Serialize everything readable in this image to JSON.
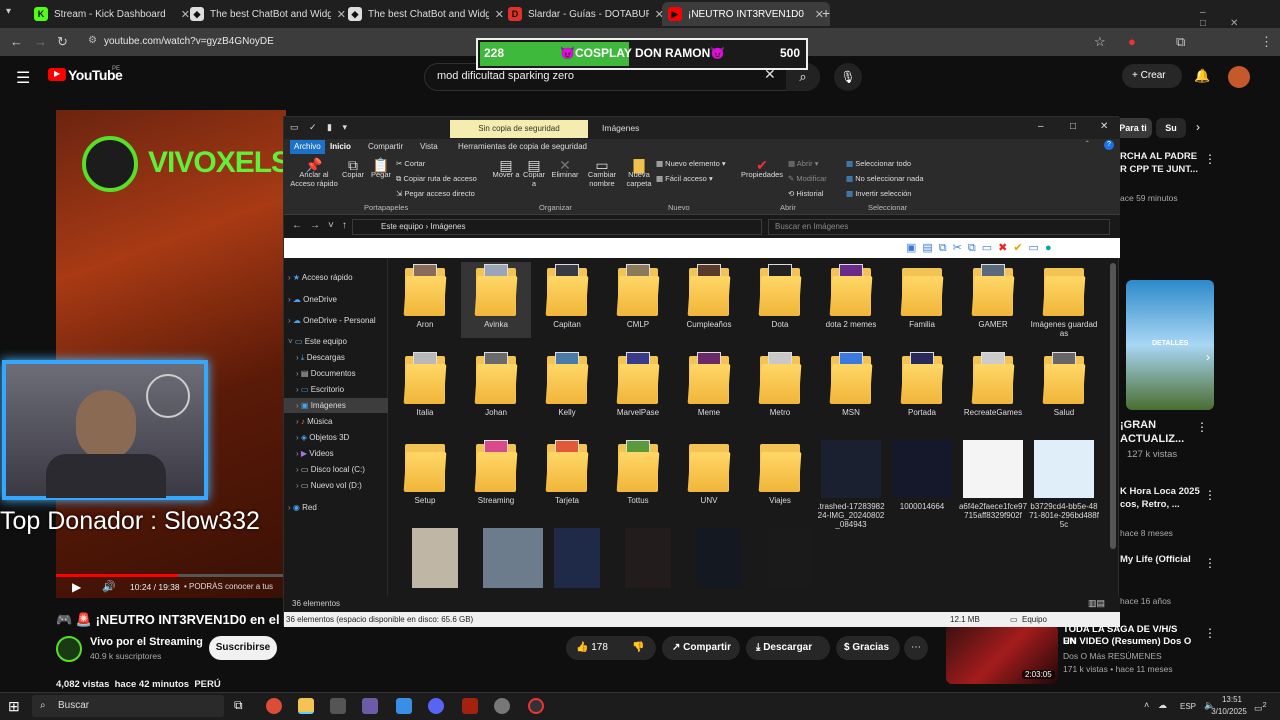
{
  "browser": {
    "tabs": [
      {
        "label": "Stream - Kick Dashboard",
        "icon": "kick-icon",
        "color": "#53fc18",
        "letter": "K"
      },
      {
        "label": "The best ChatBot and Widgets",
        "icon": "botrix-icon",
        "color": "#dddddd",
        "letter": "◆"
      },
      {
        "label": "The best ChatBot and Widgets",
        "icon": "botrix-icon",
        "color": "#dddddd",
        "letter": "◆"
      },
      {
        "label": "Slardar - Guías - DOTABUFF - D",
        "icon": "dotabuff-icon",
        "color": "#e0322b",
        "letter": "D"
      },
      {
        "label": "¡NEUTRO INT3RVEN1D0",
        "icon": "youtube-icon",
        "color": "#ff0000",
        "letter": "▶"
      }
    ],
    "url": "youtube.com/watch?v=gyzB4GNoyDE"
  },
  "donation_goal": {
    "current": "228",
    "title": "😈COSPLAY DON RAMON😈",
    "goal": "500"
  },
  "youtube": {
    "logo": "YouTube",
    "region": "PE",
    "search_value": "mod dificultad sparking zero",
    "create_label": "Crear",
    "chips": [
      "Para ti",
      "Su"
    ],
    "video": {
      "banner": "VIVOXELST",
      "donor_text": "Top Donador : Slow332",
      "time": "10:24 / 19:38",
      "chapter": "• PODRÁS conocer a tus",
      "title": "🎮 🚨 ¡NEUTRO INT3RVEN1D0 en el E",
      "channel": "Vivo por el Streaming",
      "subs": "40.9 k suscriptores",
      "subscribe": "Suscribirse",
      "likes": "178",
      "share": "Compartir",
      "download": "Descargar",
      "thanks": "Gracias",
      "views": "4,082 vistas  hace 42 minutos  PERÚ"
    },
    "related": [
      {
        "title": "RCHA AL PADRE",
        "title2": "R CPP TE JUNT...",
        "meta": "ace 59 minutos"
      },
      {
        "title": "¡GRAN",
        "title2": "ACTUALIZ...",
        "meta": "127 k vistas",
        "badge": "DETALLES"
      },
      {
        "title": "K Hora Loca 2025",
        "title2": "cos, Retro, ...",
        "meta": "hace 8 meses"
      },
      {
        "title": "My Life (Official",
        "title2": "",
        "meta": "hace 16 años"
      },
      {
        "title": "TODA LA SAGA DE V/H/S EN",
        "title2": "UN VIDEO (Resumen) Dos O ...",
        "meta": "Dos O Más RESÚMENES",
        "meta2": "171 k vistas • hace 11 meses",
        "duration": "2:03:05"
      }
    ]
  },
  "explorer": {
    "tabs_top": [
      "Sin copia de seguridad",
      "Imágenes"
    ],
    "ribbon_tabs": [
      "Archivo",
      "Inicio",
      "Compartir",
      "Vista",
      "Herramientas de copia de seguridad"
    ],
    "clipboard": [
      "Anclar al Acceso rápido",
      "Copiar",
      "Pegar",
      "Cortar",
      "Copiar ruta de acceso",
      "Pegar acceso directo"
    ],
    "organize": [
      "Mover a",
      "Copiar a",
      "Eliminar",
      "Cambiar nombre"
    ],
    "new": [
      "Nueva carpeta",
      "Nuevo elemento",
      "Fácil acceso"
    ],
    "open": [
      "Propiedades",
      "Abrir",
      "Modificar",
      "Historial"
    ],
    "select": [
      "Seleccionar todo",
      "No seleccionar nada",
      "Invertir selección"
    ],
    "groups": [
      "Portapapeles",
      "Organizar",
      "Nuevo",
      "Abrir",
      "Seleccionar"
    ],
    "path": [
      "Este equipo",
      "Imágenes"
    ],
    "search_placeholder": "Buscar en Imágenes",
    "nav": [
      "Acceso rápido",
      "OneDrive",
      "OneDrive - Personal",
      "Este equipo",
      "Descargas",
      "Documentos",
      "Escritorio",
      "Imágenes",
      "Música",
      "Objetos 3D",
      "Videos",
      "Disco local (C:)",
      "Nuevo vol (D:)",
      "Red"
    ],
    "items": [
      "Aron",
      "Avinka",
      "Capitan",
      "CMLP",
      "Cumpleaños",
      "Dota",
      "dota 2 memes",
      "Familia",
      "GAMER",
      "Imágenes guardadas",
      "Italia",
      "Johan",
      "Kelly",
      "MarvelPase",
      "Meme",
      "Metro",
      "MSN",
      "Portada",
      "RecreateGames",
      "Salud",
      "Setup",
      "Streaming",
      "Tarjeta",
      "Tottus",
      "UNV",
      "Viajes",
      ".trashed-1728398224-IMG_20240802_084943",
      "1000014664",
      "a6f4e2faece1fce97715aff8329f902f",
      "b3729cd4-bb5e-4871-801e-296bd488f5c"
    ],
    "status": "36 elementos",
    "footer_left": "36 elementos (espacio disponible en disco: 65.6 GB)",
    "footer_size": "12.1 MB",
    "footer_right": "Equipo"
  },
  "taskbar": {
    "search": "Buscar",
    "lang": "ESP",
    "time": "13:51",
    "date": "3/10/2025",
    "notif": "2"
  }
}
